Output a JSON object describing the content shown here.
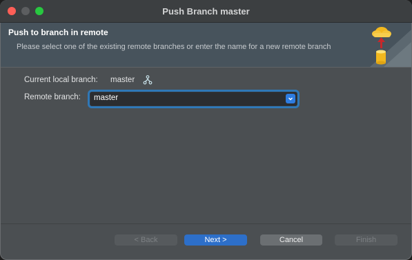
{
  "window": {
    "title": "Push Branch master"
  },
  "banner": {
    "heading": "Push to branch in remote",
    "description": "Please select one of the existing remote branches or enter the name for a new remote branch",
    "icon": "push-to-remote-icon"
  },
  "form": {
    "current_branch_label": "Current local branch:",
    "current_branch_value": "master",
    "branch_icon": "branch-icon",
    "remote_branch_label": "Remote branch:",
    "remote_branch_value": "master"
  },
  "buttons": {
    "back": "< Back",
    "next": "Next >",
    "cancel": "Cancel",
    "finish": "Finish"
  },
  "colors": {
    "accent": "#2d6fc9",
    "focus_ring": "#2f78b7",
    "close": "#ff5f57",
    "maximize": "#28c840"
  }
}
